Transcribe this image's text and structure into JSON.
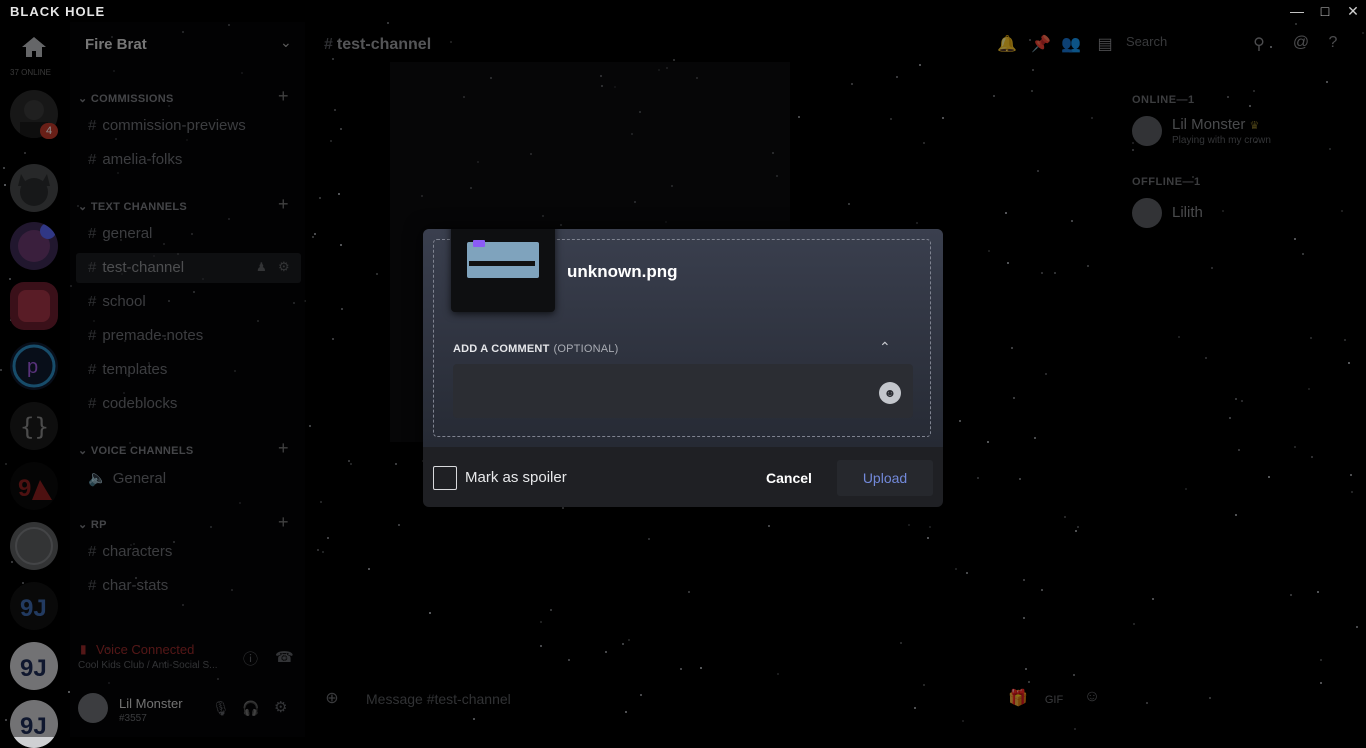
{
  "app": {
    "title": "BLACK HOLE"
  },
  "window": {
    "minimize_icon": "minimize-icon",
    "maximize_icon": "maximize-icon",
    "close_icon": "close-icon"
  },
  "rail": {
    "online_label": "37 ONLINE",
    "mention_count": "4"
  },
  "guild": {
    "name": "Fire Brat"
  },
  "categories": [
    {
      "label": "COMMISSIONS",
      "channels": [
        "commission-previews",
        "amelia-folks"
      ]
    },
    {
      "label": "TEXT CHANNELS",
      "channels": [
        "general",
        "test-channel",
        "school",
        "premade-notes",
        "templates",
        "codeblocks"
      ]
    },
    {
      "label": "VOICE CHANNELS",
      "channels": [
        "General"
      ]
    },
    {
      "label": "RP",
      "channels": [
        "characters",
        "char-stats"
      ]
    }
  ],
  "voice": {
    "status": "Voice Connected",
    "sub": "Cool Kids Club / Anti-Social S..."
  },
  "user": {
    "name": "Lil Monster",
    "tag": "#3557"
  },
  "main": {
    "channel": "test-channel",
    "search_placeholder": "Search",
    "composer_placeholder": "Message #test-channel"
  },
  "members": {
    "online_label": "ONLINE—1",
    "offline_label": "OFFLINE—1",
    "online": [
      {
        "name": "Lil Monster",
        "activity_prefix": "Playing",
        "activity": "with my crown"
      }
    ],
    "offline": [
      {
        "name": "Lilith"
      }
    ]
  },
  "modal": {
    "filename": "unknown.png",
    "comment_label": "ADD A COMMENT",
    "comment_optional": "(OPTIONAL)",
    "spoiler_label": "Mark as spoiler",
    "cancel_label": "Cancel",
    "upload_label": "Upload"
  }
}
